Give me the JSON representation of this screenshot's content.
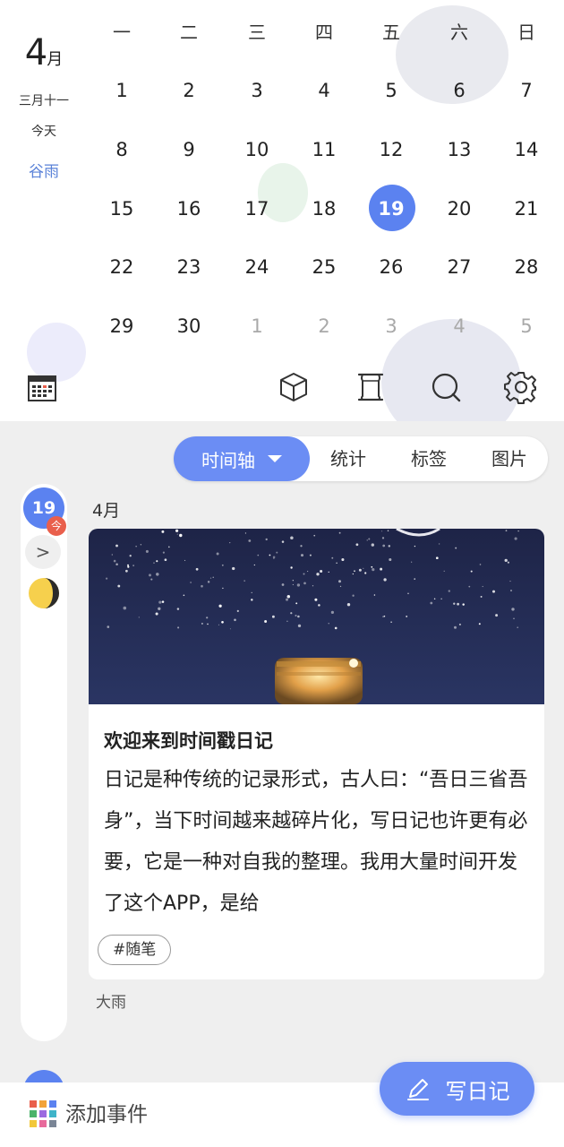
{
  "calendar": {
    "month_number": "4",
    "month_unit": "月",
    "lunar_date": "三月十一",
    "today_label": "今天",
    "solar_term": "谷雨",
    "weekdays": [
      "一",
      "二",
      "三",
      "四",
      "五",
      "六",
      "日"
    ],
    "weeks": [
      [
        "1",
        "2",
        "3",
        "4",
        "5",
        "6",
        "7"
      ],
      [
        "8",
        "9",
        "10",
        "11",
        "12",
        "13",
        "14"
      ],
      [
        "15",
        "16",
        "17",
        "18",
        "19",
        "20",
        "21"
      ],
      [
        "22",
        "23",
        "24",
        "25",
        "26",
        "27",
        "28"
      ],
      [
        "29",
        "30",
        "1",
        "2",
        "3",
        "4",
        "5"
      ]
    ],
    "selected_day": "19",
    "accent_color": "#5b82f0"
  },
  "toolbar": {
    "icons": [
      "calendar-grid-icon",
      "cube-icon",
      "scroll-icon",
      "search-icon",
      "gear-icon"
    ]
  },
  "tabs": {
    "timeline": "时间轴",
    "stats": "统计",
    "tags": "标签",
    "images": "图片"
  },
  "rail": {
    "date": "19",
    "today_badge": "今",
    "expand": ">",
    "moon_icon": "half-moon-icon"
  },
  "entry": {
    "month_label": "4月",
    "title": "欢迎来到时间戳日记",
    "body": "日记是种传统的记录形式，古人曰：“吾日三省吾身”，当下时间越来越碎片化，写日记也许更有必要，它是一种对自我的整理。我用大量时间开发了这个APP，是给",
    "tag": "#随笔",
    "weather": "大雨"
  },
  "bottom": {
    "add_event": "添加事件",
    "write_button": "写日记"
  }
}
